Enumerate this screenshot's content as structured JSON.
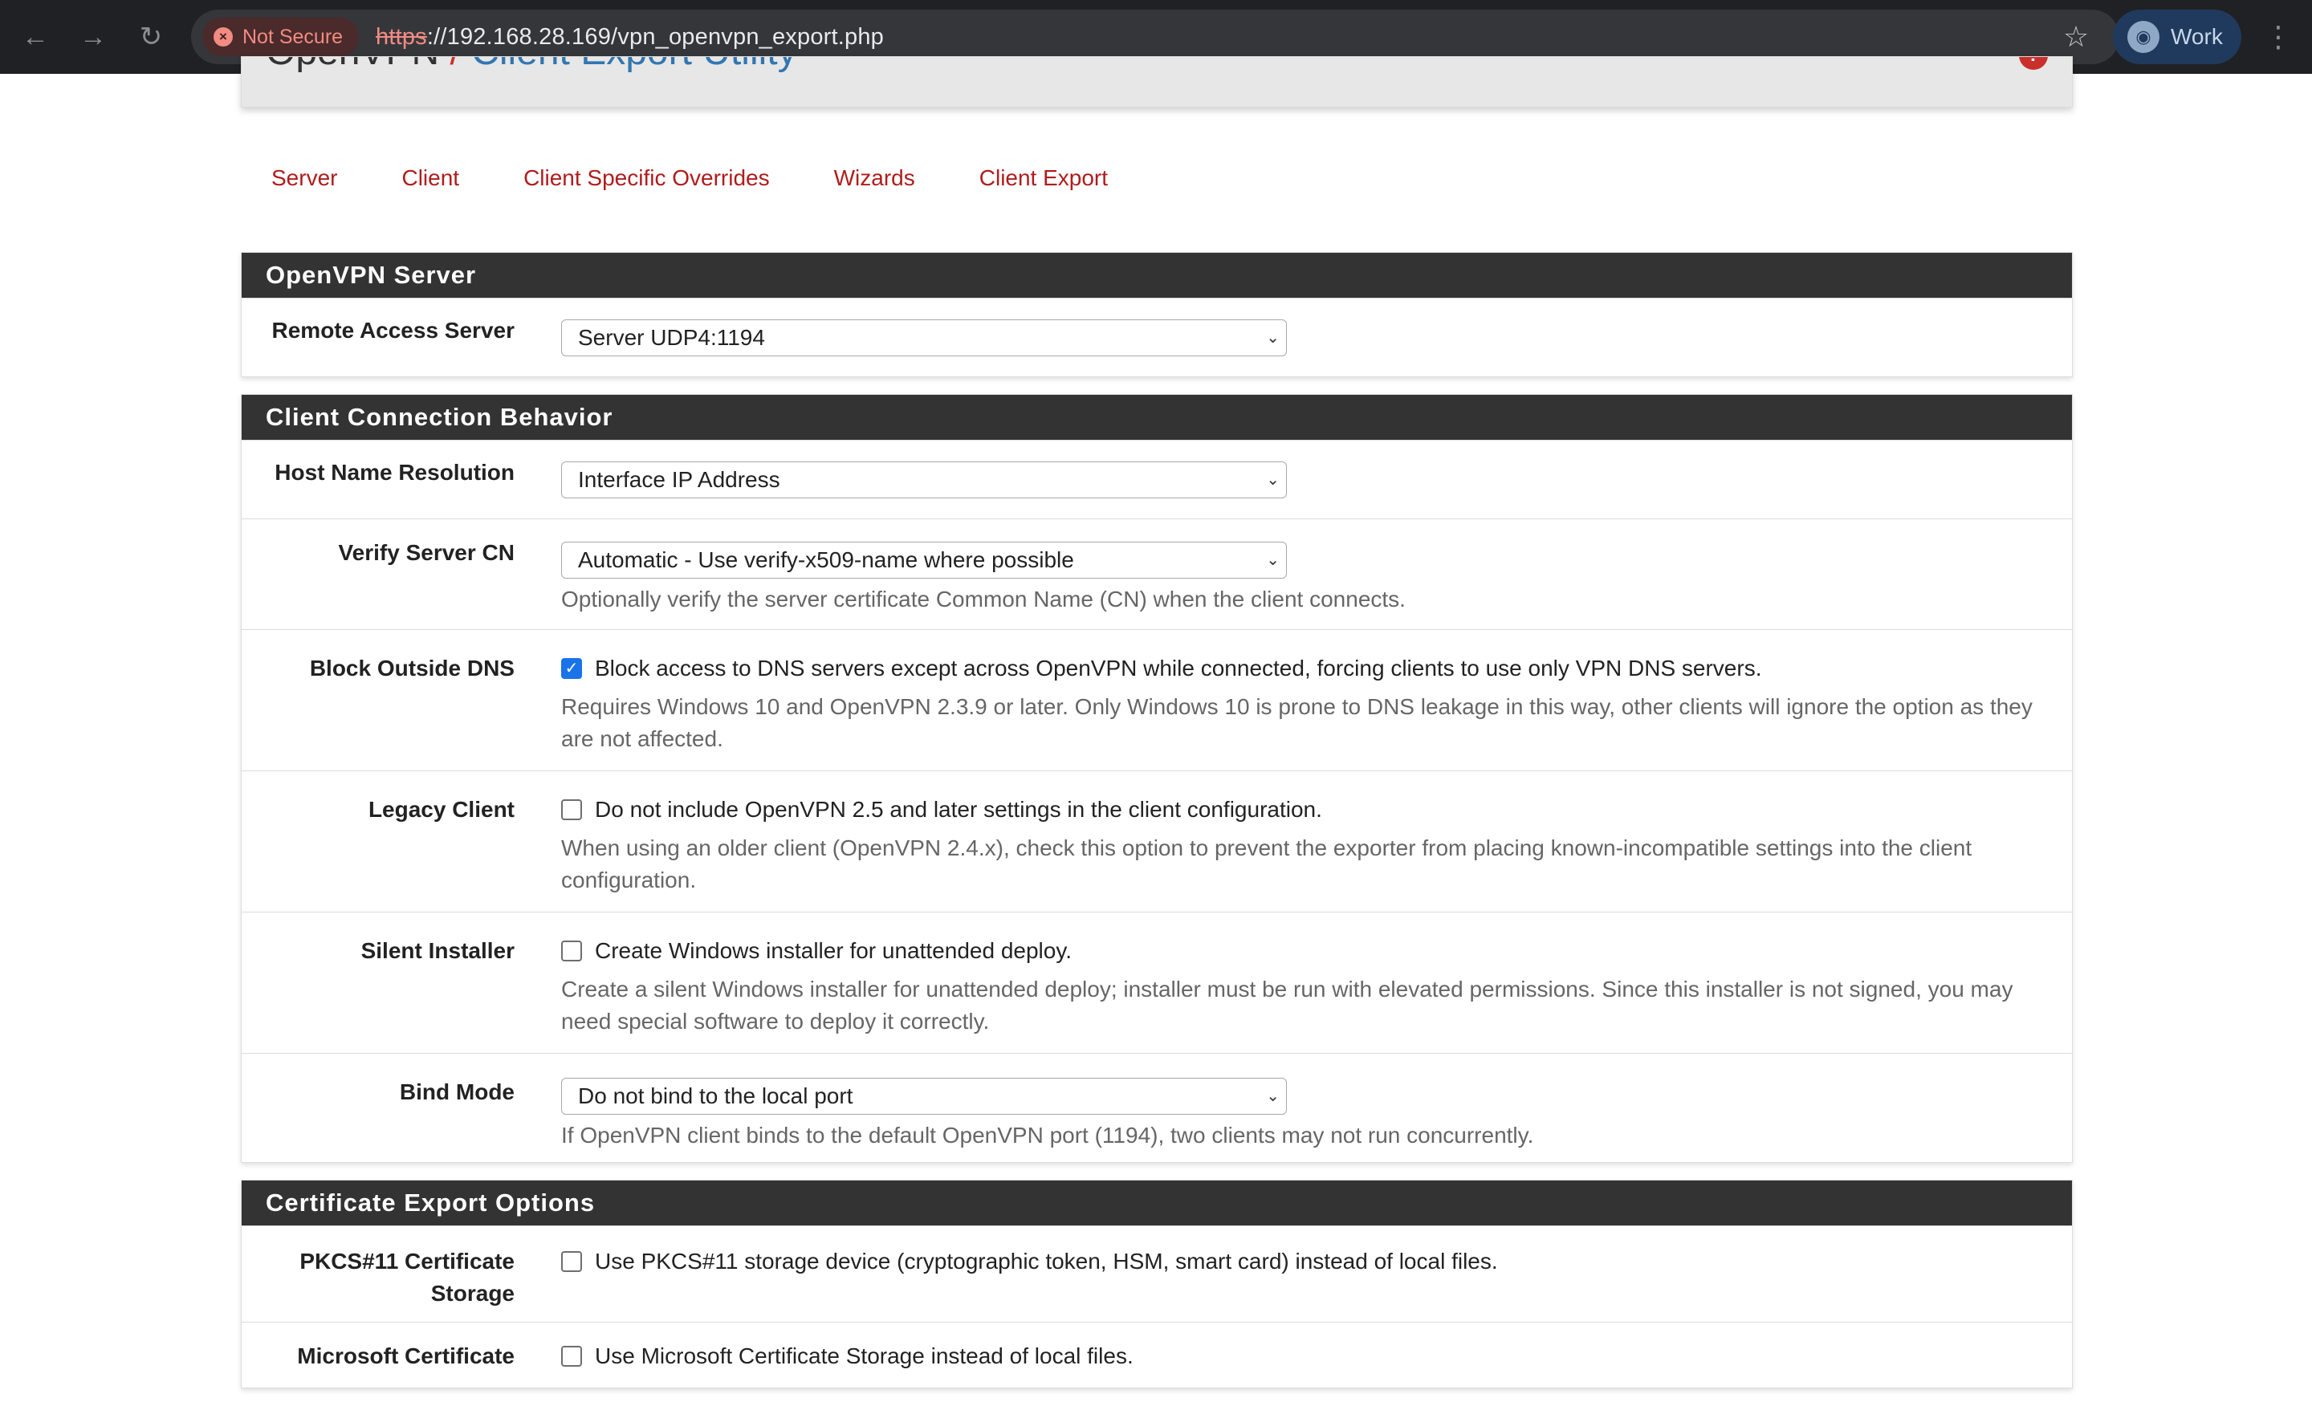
{
  "browser": {
    "back_icon": "arrow-left-icon",
    "forward_icon": "arrow-right-icon",
    "reload_icon": "reload-icon",
    "security_label": "Not Secure",
    "url_scheme": "https",
    "url_rest": "://192.168.28.169/vpn_openvpn_export.php",
    "profile_label": "Work"
  },
  "header": {
    "parent": "OpenVPN",
    "separator": "/",
    "current": "Client Export Utility"
  },
  "tabs": [
    {
      "label": "Server"
    },
    {
      "label": "Client"
    },
    {
      "label": "Client Specific Overrides"
    },
    {
      "label": "Wizards"
    },
    {
      "label": "Client Export"
    }
  ],
  "openvpn_server": {
    "heading": "OpenVPN Server",
    "remote_access_server": {
      "label": "Remote Access Server",
      "value": "Server UDP4:1194"
    }
  },
  "client_connection": {
    "heading": "Client Connection Behavior",
    "host_name_resolution": {
      "label": "Host Name Resolution",
      "value": "Interface IP Address"
    },
    "verify_server_cn": {
      "label": "Verify Server CN",
      "value": "Automatic - Use verify-x509-name where possible",
      "help": "Optionally verify the server certificate Common Name (CN) when the client connects."
    },
    "block_outside_dns": {
      "label": "Block Outside DNS",
      "checked": true,
      "option": "Block access to DNS servers except across OpenVPN while connected, forcing clients to use only VPN DNS servers.",
      "help": "Requires Windows 10 and OpenVPN 2.3.9 or later. Only Windows 10 is prone to DNS leakage in this way, other clients will ignore the option as they are not affected."
    },
    "legacy_client": {
      "label": "Legacy Client",
      "checked": false,
      "option": "Do not include OpenVPN 2.5 and later settings in the client configuration.",
      "help": "When using an older client (OpenVPN 2.4.x), check this option to prevent the exporter from placing known-incompatible settings into the client configuration."
    },
    "silent_installer": {
      "label": "Silent Installer",
      "checked": false,
      "option": "Create Windows installer for unattended deploy.",
      "help": "Create a silent Windows installer for unattended deploy; installer must be run with elevated permissions. Since this installer is not signed, you may need special software to deploy it correctly."
    },
    "bind_mode": {
      "label": "Bind Mode",
      "value": "Do not bind to the local port",
      "help": "If OpenVPN client binds to the default OpenVPN port (1194), two clients may not run concurrently."
    }
  },
  "certificate_export": {
    "heading": "Certificate Export Options",
    "pkcs11": {
      "label": "PKCS#11 Certificate Storage",
      "checked": false,
      "option": "Use PKCS#11 storage device (cryptographic token, HSM, smart card) instead of local files."
    },
    "microsoft_cert": {
      "label": "Microsoft Certificate",
      "checked": false,
      "option": "Use Microsoft Certificate Storage instead of local files."
    }
  }
}
